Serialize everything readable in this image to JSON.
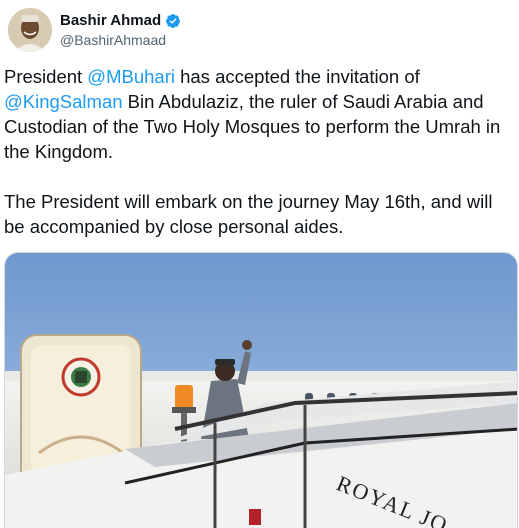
{
  "user": {
    "display_name": "Bashir Ahmad",
    "handle": "@BashirAhmaad",
    "verified": true,
    "verified_icon": "verified-badge-icon"
  },
  "tweet": {
    "p1_before": "President ",
    "mention_buhari": "@MBuhari",
    "p1_mid": " has accepted the invitation of ",
    "mention_king": "@KingSalman",
    "p1_after": " Bin Abdulaziz, the ruler of Saudi Arabia and Custodian of the Two Holy Mosques to perform the Umrah in the Kingdom.",
    "p2": "The President will embark on the journey May 16th, and will be accompanied by close personal aides."
  },
  "media": {
    "aircraft_lettering": "ROYAL JO"
  },
  "colors": {
    "mention": "#1d9bf0",
    "text": "#0f1419",
    "secondary": "#536471",
    "sky": "#7fa6d6"
  }
}
